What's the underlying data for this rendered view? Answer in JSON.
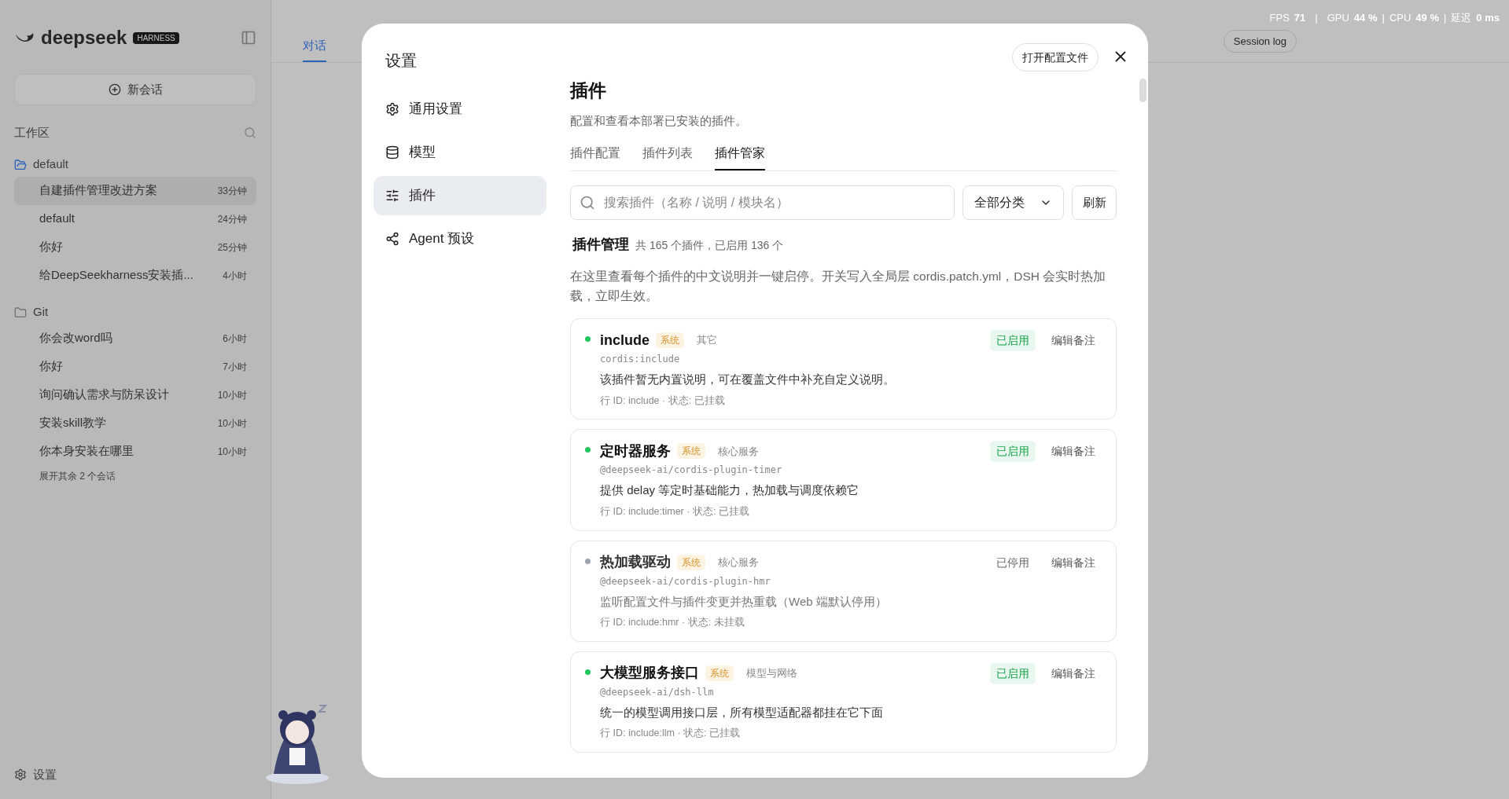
{
  "perf_overlay": {
    "separators": [
      "|",
      "|",
      "|"
    ],
    "fps_label": "FPS",
    "fps": "71",
    "gpu_label": "GPU",
    "gpu": "44 %",
    "cpu_label": "CPU",
    "cpu": "49 %",
    "latency_label": "延迟",
    "latency": "0 ms"
  },
  "background": {
    "logo": "deepseek",
    "logo_badge": "HARNESS",
    "new_chat": "新会话",
    "workspace_label": "工作区",
    "folders": [
      {
        "name": "default",
        "selected": true,
        "chats": [
          {
            "title": "自建插件管理改进方案",
            "time": "33分钟",
            "selected": true
          },
          {
            "title": "default",
            "time": "24分钟",
            "selected": false
          },
          {
            "title": "你好",
            "time": "25分钟",
            "selected": false
          },
          {
            "title": "给DeepSeekharness安装插...",
            "time": "4小时",
            "selected": false
          }
        ]
      },
      {
        "name": "Git",
        "selected": false,
        "chats": [
          {
            "title": "你会改word吗",
            "time": "6小时",
            "selected": false
          },
          {
            "title": "你好",
            "time": "7小时",
            "selected": false
          },
          {
            "title": "询问确认需求与防呆设计",
            "time": "10小时",
            "selected": false
          },
          {
            "title": "安装skill教学",
            "time": "10小时",
            "selected": false
          },
          {
            "title": "你本身安装在哪里",
            "time": "10小时",
            "selected": false
          }
        ]
      }
    ],
    "more_chats": "展开其余 2 个会话",
    "settings": "设置",
    "tab": "对话",
    "session_log": "Session log"
  },
  "dialog": {
    "title": "设置",
    "open_config_button": "打开配置文件",
    "nav": [
      {
        "label": "通用设置",
        "selected": false
      },
      {
        "label": "模型",
        "selected": false
      },
      {
        "label": "插件",
        "selected": true
      },
      {
        "label": "Agent 预设",
        "selected": false
      }
    ],
    "heading": "插件",
    "subheading": "配置和查看本部署已安装的插件。",
    "tabs": [
      {
        "label": "插件配置",
        "selected": false
      },
      {
        "label": "插件列表",
        "selected": false
      },
      {
        "label": "插件管家",
        "selected": true
      }
    ],
    "search": {
      "placeholder": "搜索插件（名称 / 说明 / 模块名）"
    },
    "category_select": "全部分类",
    "refresh_button": "刷新",
    "section_title": "插件管理",
    "section_count": "共 165 个插件，已启用 136 个",
    "section_desc": "在这里查看每个插件的中文说明并一键启停。开关写入全局层 cordis.patch.yml，DSH 会实时热加载，立即生效。",
    "plugins": [
      {
        "name": "include",
        "tag": "系统",
        "category": "其它",
        "module": "cordis:include",
        "description": "该插件暂无内置说明，可在覆盖文件中补充自定义说明。",
        "meta": "行 ID: include · 状态: 已挂载",
        "enabled": true,
        "status": "已启用",
        "note_button": "编辑备注"
      },
      {
        "name": "定时器服务",
        "tag": "系统",
        "category": "核心服务",
        "module": "@deepseek-ai/cordis-plugin-timer",
        "description": "提供 delay 等定时基础能力，热加载与调度依赖它",
        "meta": "行 ID: include:timer · 状态: 已挂载",
        "enabled": true,
        "status": "已启用",
        "note_button": "编辑备注"
      },
      {
        "name": "热加载驱动",
        "tag": "系统",
        "category": "核心服务",
        "module": "@deepseek-ai/cordis-plugin-hmr",
        "description": "监听配置文件与插件变更并热重载（Web 端默认停用）",
        "meta": "行 ID: include:hmr · 状态: 未挂载",
        "enabled": false,
        "status": "已停用",
        "note_button": "编辑备注"
      },
      {
        "name": "大模型服务接口",
        "tag": "系统",
        "category": "模型与网络",
        "module": "@deepseek-ai/dsh-llm",
        "description": "统一的模型调用接口层，所有模型适配器都挂在它下面",
        "meta": "行 ID: include:llm · 状态: 已挂载",
        "enabled": true,
        "status": "已启用",
        "note_button": "编辑备注"
      }
    ]
  }
}
